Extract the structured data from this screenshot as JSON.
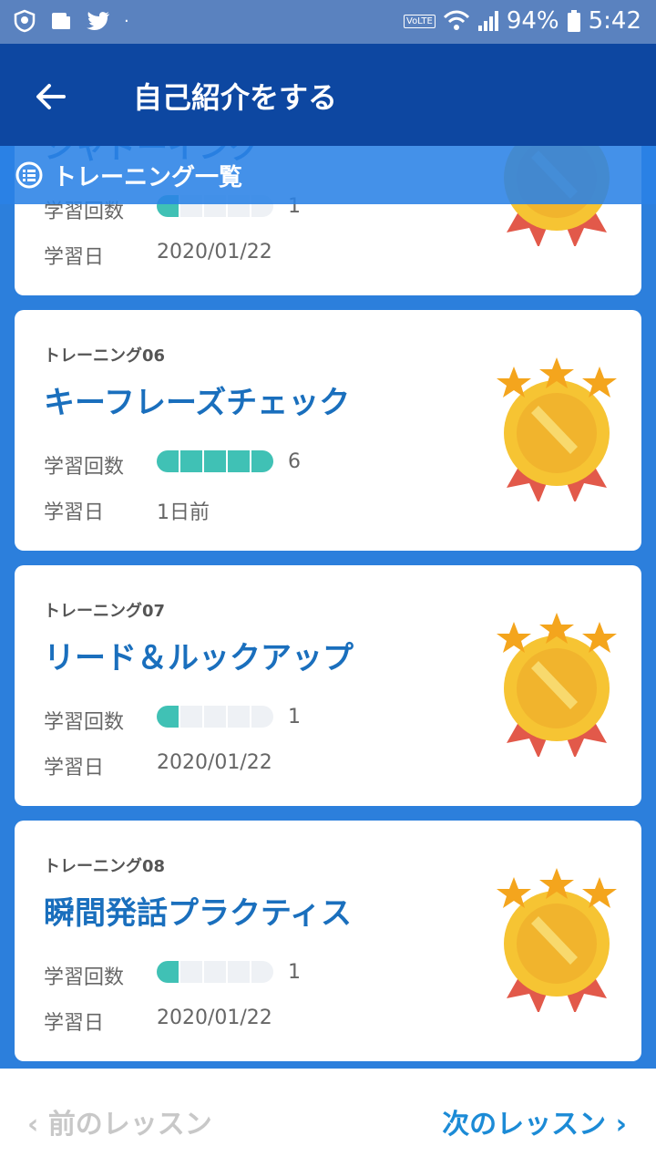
{
  "status": {
    "battery": "94%",
    "time": "5:42",
    "network": "VoLTE"
  },
  "header": {
    "title": "自己紹介をする",
    "back_icon": "back-arrow-icon"
  },
  "strip": {
    "label": "トレーニング一覧"
  },
  "labels": {
    "count": "学習回数",
    "date": "学習日"
  },
  "cards": [
    {
      "title": "シャドーイング",
      "count": "1",
      "date": "2020/01/22",
      "progress": 1
    },
    {
      "num": "トレーニング06",
      "title": "キーフレーズチェック",
      "count": "6",
      "date": "1日前",
      "progress": 5
    },
    {
      "num": "トレーニング07",
      "title": "リード＆ルックアップ",
      "count": "1",
      "date": "2020/01/22",
      "progress": 1
    },
    {
      "num": "トレーニング08",
      "title": "瞬間発話プラクティス",
      "count": "1",
      "date": "2020/01/22",
      "progress": 1
    }
  ],
  "footer": {
    "prev": "前のレッスン",
    "next": "次のレッスン"
  }
}
